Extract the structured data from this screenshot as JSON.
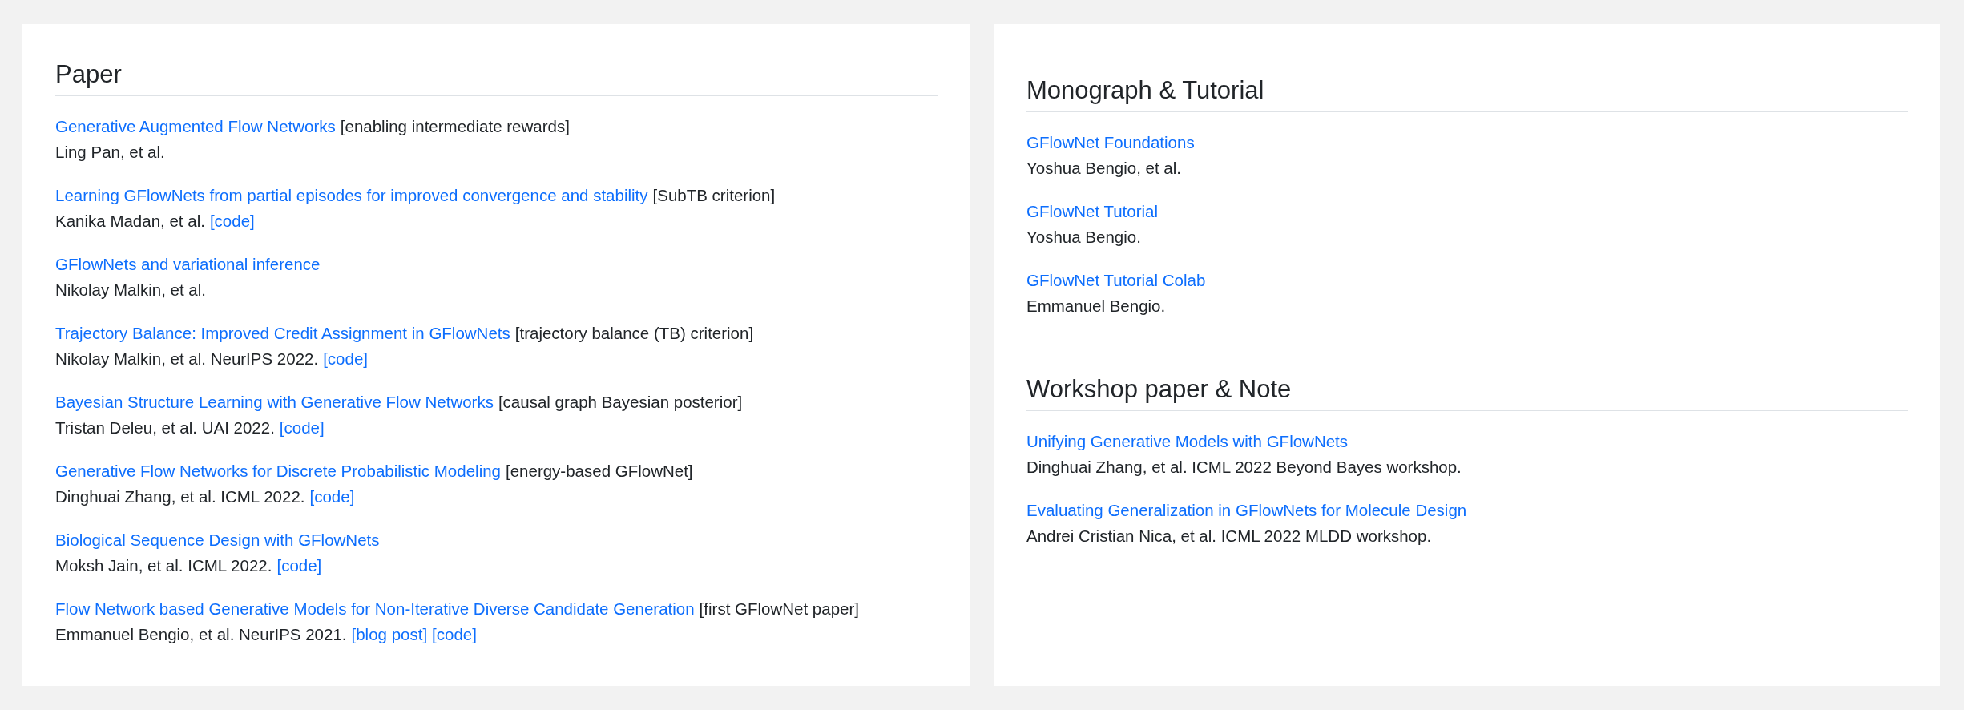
{
  "panels": [
    {
      "sections": [
        {
          "heading": "Paper",
          "entries": [
            {
              "title": "Generative Augmented Flow Networks",
              "note": "[enabling intermediate rewards]",
              "authors": "Ling Pan, et al."
            },
            {
              "title": "Learning GFlowNets from partial episodes for improved convergence and stability",
              "note": "[SubTB criterion]",
              "authors": "Kanika Madan, et al.",
              "links": [
                "[code]"
              ]
            },
            {
              "title": "GFlowNets and variational inference",
              "authors": "Nikolay Malkin, et al."
            },
            {
              "title": "Trajectory Balance: Improved Credit Assignment in GFlowNets",
              "note": "[trajectory balance (TB) criterion]",
              "authors": "Nikolay Malkin, et al. NeurIPS 2022.",
              "links": [
                "[code]"
              ]
            },
            {
              "title": "Bayesian Structure Learning with Generative Flow Networks",
              "note": "[causal graph Bayesian posterior]",
              "authors": "Tristan Deleu, et al. UAI 2022.",
              "links": [
                "[code]"
              ]
            },
            {
              "title": "Generative Flow Networks for Discrete Probabilistic Modeling",
              "note": "[energy-based GFlowNet]",
              "authors": "Dinghuai Zhang, et al. ICML 2022.",
              "links": [
                "[code]"
              ]
            },
            {
              "title": "Biological Sequence Design with GFlowNets",
              "authors": "Moksh Jain, et al. ICML 2022.",
              "links": [
                "[code]"
              ]
            },
            {
              "title": "Flow Network based Generative Models for Non-Iterative Diverse Candidate Generation",
              "note": "[first GFlowNet paper]",
              "authors": "Emmanuel Bengio, et al. NeurIPS 2021.",
              "links": [
                "[blog post]",
                "[code]"
              ]
            }
          ]
        }
      ]
    },
    {
      "sections": [
        {
          "heading": "Monograph & Tutorial",
          "entries": [
            {
              "title": "GFlowNet Foundations",
              "authors": "Yoshua Bengio, et al."
            },
            {
              "title": "GFlowNet Tutorial",
              "authors": "Yoshua Bengio."
            },
            {
              "title": "GFlowNet Tutorial Colab",
              "authors": "Emmanuel Bengio."
            }
          ]
        },
        {
          "heading": "Workshop paper & Note",
          "entries": [
            {
              "title": "Unifying Generative Models with GFlowNets",
              "authors": "Dinghuai Zhang, et al. ICML 2022 Beyond Bayes workshop."
            },
            {
              "title": "Evaluating Generalization in GFlowNets for Molecule Design",
              "authors": "Andrei Cristian Nica, et al. ICML 2022 MLDD workshop."
            }
          ]
        }
      ]
    }
  ]
}
